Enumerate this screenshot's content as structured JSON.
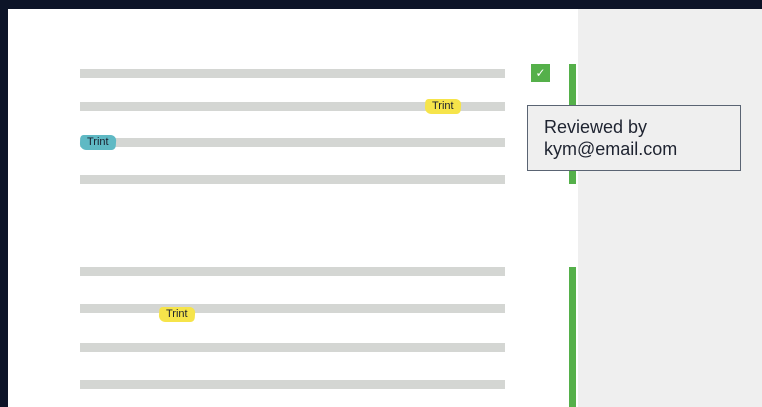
{
  "colors": {
    "background": "#0d1428",
    "document": "#ffffff",
    "sidebar": "#efefef",
    "text_line": "#d4d6d3",
    "highlight_yellow": "#f6e44a",
    "highlight_teal": "#5fb9c4",
    "accent_green": "#55b04a"
  },
  "highlights": [
    {
      "label": "Trint",
      "color": "yellow"
    },
    {
      "label": "Trint",
      "color": "teal"
    },
    {
      "label": "Trint",
      "color": "yellow"
    }
  ],
  "review": {
    "checked": true,
    "check_icon": "checkmark-icon",
    "text_line1": "Reviewed by",
    "text_line2": "kym@email.com"
  }
}
